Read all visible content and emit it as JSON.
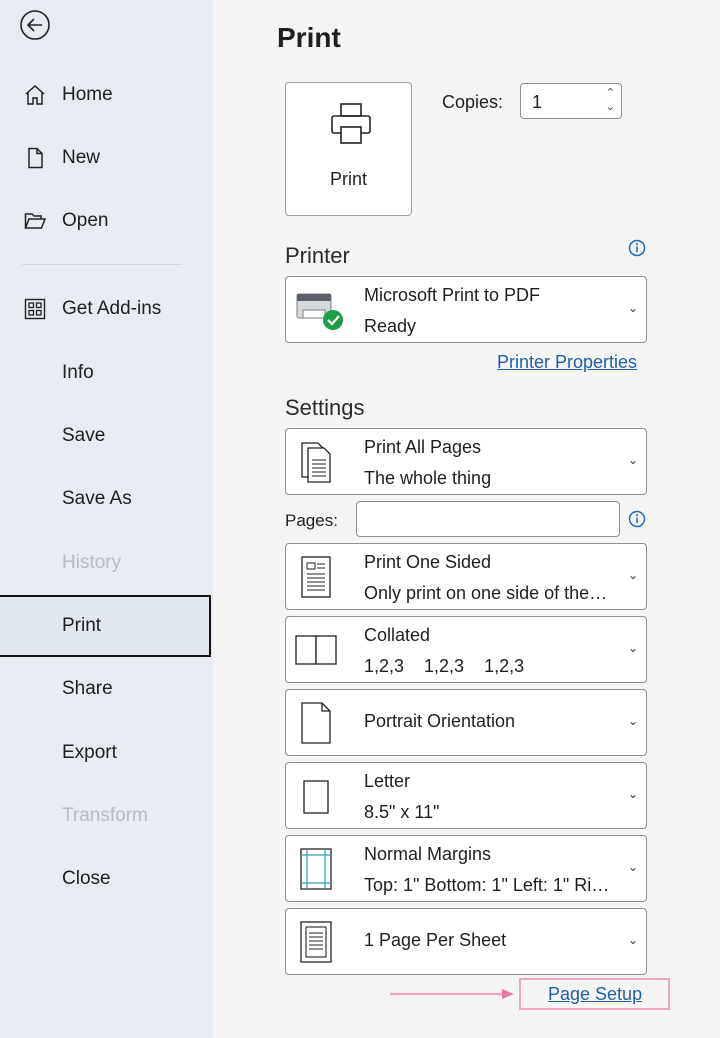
{
  "sidebar": {
    "back": {
      "icon": "back-arrow-icon"
    },
    "items": [
      {
        "label": "Home",
        "icon": "home-icon",
        "state": "normal"
      },
      {
        "label": "New",
        "icon": "new-document-icon",
        "state": "normal"
      },
      {
        "label": "Open",
        "icon": "folder-open-icon",
        "state": "normal"
      },
      {
        "label": "Get Add-ins",
        "icon": "add-ins-grid-icon",
        "state": "normal"
      },
      {
        "label": "Info",
        "state": "normal"
      },
      {
        "label": "Save",
        "state": "normal"
      },
      {
        "label": "Save As",
        "state": "normal"
      },
      {
        "label": "History",
        "state": "disabled"
      },
      {
        "label": "Print",
        "state": "selected"
      },
      {
        "label": "Share",
        "state": "normal"
      },
      {
        "label": "Export",
        "state": "normal"
      },
      {
        "label": "Transform",
        "state": "disabled"
      },
      {
        "label": "Close",
        "state": "normal"
      }
    ]
  },
  "main": {
    "title": "Print",
    "print_button": {
      "label": "Print",
      "icon": "printer-icon"
    },
    "copies": {
      "label": "Copies:",
      "value": "1"
    },
    "printer": {
      "heading": "Printer",
      "name": "Microsoft Print to PDF",
      "status": "Ready",
      "properties_link": "Printer Properties",
      "icon": "printer-ready-icon"
    },
    "settings": {
      "heading": "Settings",
      "pages_label": "Pages:",
      "pages_value": "",
      "options": [
        {
          "line1": "Print All Pages",
          "line2": "The whole thing",
          "icon": "pages-icon"
        },
        {
          "line1": "Print One Sided",
          "line2": "Only print on one side of the…",
          "icon": "one-sided-icon"
        },
        {
          "line1": "Collated",
          "line2": "1,2,3    1,2,3    1,2,3",
          "icon": "collated-icon"
        },
        {
          "line1": "Portrait Orientation",
          "line2": "",
          "icon": "portrait-icon"
        },
        {
          "line1": "Letter",
          "line2": "8.5\" x 11\"",
          "icon": "paper-size-icon"
        },
        {
          "line1": "Normal Margins",
          "line2": "Top: 1\" Bottom: 1\" Left: 1\" Ri…",
          "icon": "margins-icon"
        },
        {
          "line1": "1 Page Per Sheet",
          "line2": "",
          "icon": "pages-per-sheet-icon"
        }
      ],
      "page_setup_link": "Page Setup"
    }
  },
  "colors": {
    "sidebar_bg": "#e7ecf2",
    "main_bg": "#f5f5f5",
    "link": "#1f5fa8",
    "highlight": "#f2a5c5",
    "check_green": "#1e9e48"
  }
}
